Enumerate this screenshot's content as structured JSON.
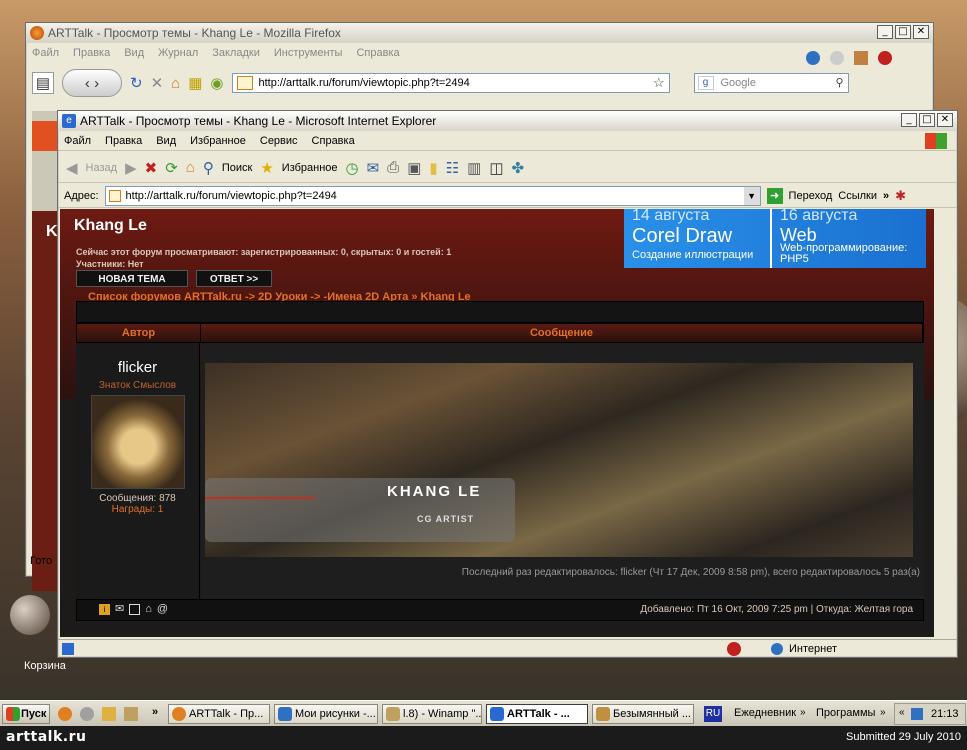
{
  "desktop": {
    "recycle_label": "Корзина"
  },
  "firefox": {
    "title": "ARTTalk - Просмотр темы - Khang Le - Mozilla Firefox",
    "menu": [
      "Файл",
      "Правка",
      "Вид",
      "Журнал",
      "Закладки",
      "Инструменты",
      "Справка"
    ],
    "url": "http://arttalk.ru/forum/viewtopic.php?t=2494",
    "search_placeholder": "Google",
    "side_fragments": {
      "k": "K",
      "go": "Гото"
    }
  },
  "ie": {
    "title": "ARTTalk - Просмотр темы - Khang Le - Microsoft Internet Explorer",
    "menu": [
      "Файл",
      "Правка",
      "Вид",
      "Избранное",
      "Сервис",
      "Справка"
    ],
    "toolbar": {
      "back": "Назад",
      "search": "Поиск",
      "favorites": "Избранное"
    },
    "address_label": "Адрес:",
    "url": "http://arttalk.ru/forum/viewtopic.php?t=2494",
    "go": "Переход",
    "links": "Ссылки",
    "status_zone": "Интернет"
  },
  "forum": {
    "topic_title": "Khang Le",
    "viewers": "Сейчас этот форум просматривают: зарегистрированных: 0, скрытых: 0 и гостей: 1",
    "participants": "Участники: Нет",
    "btn_new": "НОВАЯ ТЕМА",
    "btn_reply": "ОТВЕТ >>",
    "breadcrumb": "Список форумов ARTTalk.ru -> 2D Уроки -> -Имена 2D Арта » Khang Le",
    "col_author": "Автор",
    "col_message": "Сообщение",
    "ad": {
      "date1": "14 августа",
      "title1": "Corel Draw",
      "sub1": "Создание иллюстрации",
      "date2": "16 августа",
      "title2": "Web",
      "sub2": "Web-программирование: PHP5"
    },
    "post": {
      "username": "flicker",
      "rank": "Знаток Смыслов",
      "messages": "Сообщения: 878",
      "awards": "Награды: 1",
      "banner_name": "KHANG LE",
      "banner_role": "CG ARTIST",
      "edited": "Последний раз редактировалось: flicker (Чт 17 Дек, 2009 8:58 pm), всего редактировалось 5 раз(а)",
      "added": "Добавлено: Пт 16 Окт, 2009 7:25 pm | Откуда: Желтая гора"
    }
  },
  "taskbar": {
    "start": "Пуск",
    "tasks": [
      "ARTTalk - Пр...",
      "Мои рисунки -...",
      "l.8) - Winamp \"...",
      "ARTTalk - ...",
      "Безымянный ..."
    ],
    "lang": "RU",
    "tray1": "Ежедневник",
    "tray2": "Программы",
    "clock": "21:13"
  },
  "footer": {
    "logo": "arttalk.ru",
    "submitted": "Submitted 29 July 2010"
  }
}
